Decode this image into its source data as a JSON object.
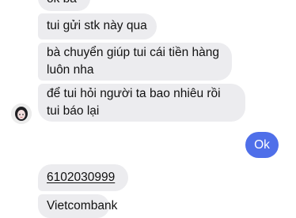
{
  "conversation": {
    "incoming": [
      {
        "text": "ok bà"
      },
      {
        "text": "tui gửi stk này qua"
      },
      {
        "text": "bà chuyển giúp tui cái tiền hàng luôn nha"
      },
      {
        "text": "để tui hỏi người ta bao nhiêu rồi tui báo lại"
      }
    ],
    "outgoing": [
      {
        "text": "Ok"
      }
    ],
    "incoming_after": [
      {
        "text": "6102030999"
      },
      {
        "text": "Vietcombank"
      }
    ]
  },
  "colors": {
    "incoming_bubble": "#ececef",
    "outgoing_bubble": "#4f6fe9",
    "text_dark": "#111111",
    "text_light": "#ffffff"
  }
}
